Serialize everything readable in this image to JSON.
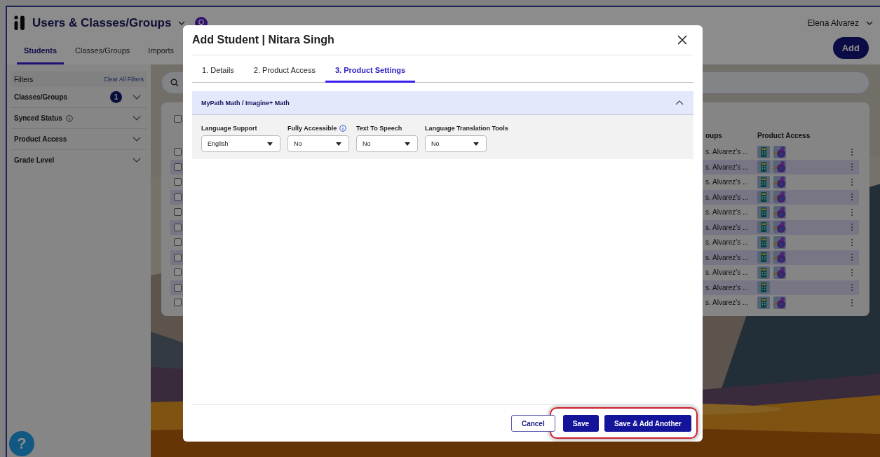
{
  "app": {
    "title": "Users & Classes/Groups",
    "user": "Elena Alvarez"
  },
  "tabs": [
    {
      "label": "Students",
      "selected": true
    },
    {
      "label": "Classes/Groups",
      "selected": false
    },
    {
      "label": "Imports",
      "selected": false
    }
  ],
  "add_button": "Add",
  "filters": {
    "title": "Filters",
    "clear": "Clear All Filters",
    "items": [
      {
        "label": "Classes/Groups",
        "count": "1",
        "info": false,
        "expanded": false
      },
      {
        "label": "Synced Status",
        "info": true,
        "expanded": false
      },
      {
        "label": "Product Access",
        "info": false,
        "expanded": false
      },
      {
        "label": "Grade Level",
        "info": false,
        "expanded": false
      }
    ]
  },
  "table": {
    "select_all": {
      "checked": false
    },
    "columns": [
      "oups",
      "Product Access"
    ],
    "rows": [
      {
        "checked": false,
        "column_1": "s. Alvarez's ...",
        "product_access": [
          {
            "kind": "calculator"
          },
          {
            "kind": "creature"
          }
        ]
      },
      {
        "checked": false,
        "column_1": "s. Alvarez's ...",
        "product_access": [
          {
            "kind": "calculator"
          },
          {
            "kind": "creature"
          }
        ]
      },
      {
        "checked": false,
        "column_1": "s. Alvarez's ...",
        "product_access": [
          {
            "kind": "calculator"
          },
          {
            "kind": "creature"
          }
        ]
      },
      {
        "checked": false,
        "column_1": "s. Alvarez's ...",
        "product_access": [
          {
            "kind": "calculator"
          },
          {
            "kind": "creature"
          }
        ]
      },
      {
        "checked": false,
        "column_1": "s. Alvarez's ...",
        "product_access": [
          {
            "kind": "calculator"
          },
          {
            "kind": "creature"
          }
        ]
      },
      {
        "checked": false,
        "column_1": "s. Alvarez's ...",
        "product_access": [
          {
            "kind": "calculator"
          },
          {
            "kind": "creature"
          }
        ]
      },
      {
        "checked": false,
        "column_1": "s. Alvarez's ...",
        "product_access": [
          {
            "kind": "calculator"
          },
          {
            "kind": "creature"
          }
        ]
      },
      {
        "checked": false,
        "column_1": "s. Alvarez's ...",
        "product_access": [
          {
            "kind": "calculator"
          },
          {
            "kind": "creature"
          }
        ]
      },
      {
        "checked": false,
        "column_1": "s. Alvarez's ...",
        "product_access": [
          {
            "kind": "calculator"
          },
          {
            "kind": "creature"
          }
        ]
      },
      {
        "checked": false,
        "column_1": "s. Alvarez's ...",
        "product_access": [
          {
            "kind": "calculator"
          }
        ]
      },
      {
        "checked": false,
        "column_1": "s. Alvarez's ...",
        "product_access": [
          {
            "kind": "calculator"
          },
          {
            "kind": "creature"
          }
        ]
      }
    ]
  },
  "help_button": "?",
  "modal": {
    "title": "Add Student | Nitara Singh",
    "tabs": [
      {
        "label": "1. Details",
        "selected": false
      },
      {
        "label": "2. Product Access",
        "selected": false
      },
      {
        "label": "3. Product Settings",
        "selected": true
      }
    ],
    "section": {
      "title": "MyPath Math / Imagine+ Math",
      "expanded": true,
      "settings": [
        {
          "label": "Language Support",
          "value": "English",
          "info": false
        },
        {
          "label": "Fully Accessible",
          "value": "No",
          "info": true
        },
        {
          "label": "Text To Speech",
          "value": "No",
          "info": false
        },
        {
          "label": "Language Translation Tools",
          "value": "No",
          "info": false
        }
      ]
    },
    "buttons": [
      {
        "label": "Cancel",
        "kind": "secondary"
      },
      {
        "label": "Save",
        "kind": "primary"
      },
      {
        "label": "Save & Add Another",
        "kind": "primary"
      }
    ]
  }
}
